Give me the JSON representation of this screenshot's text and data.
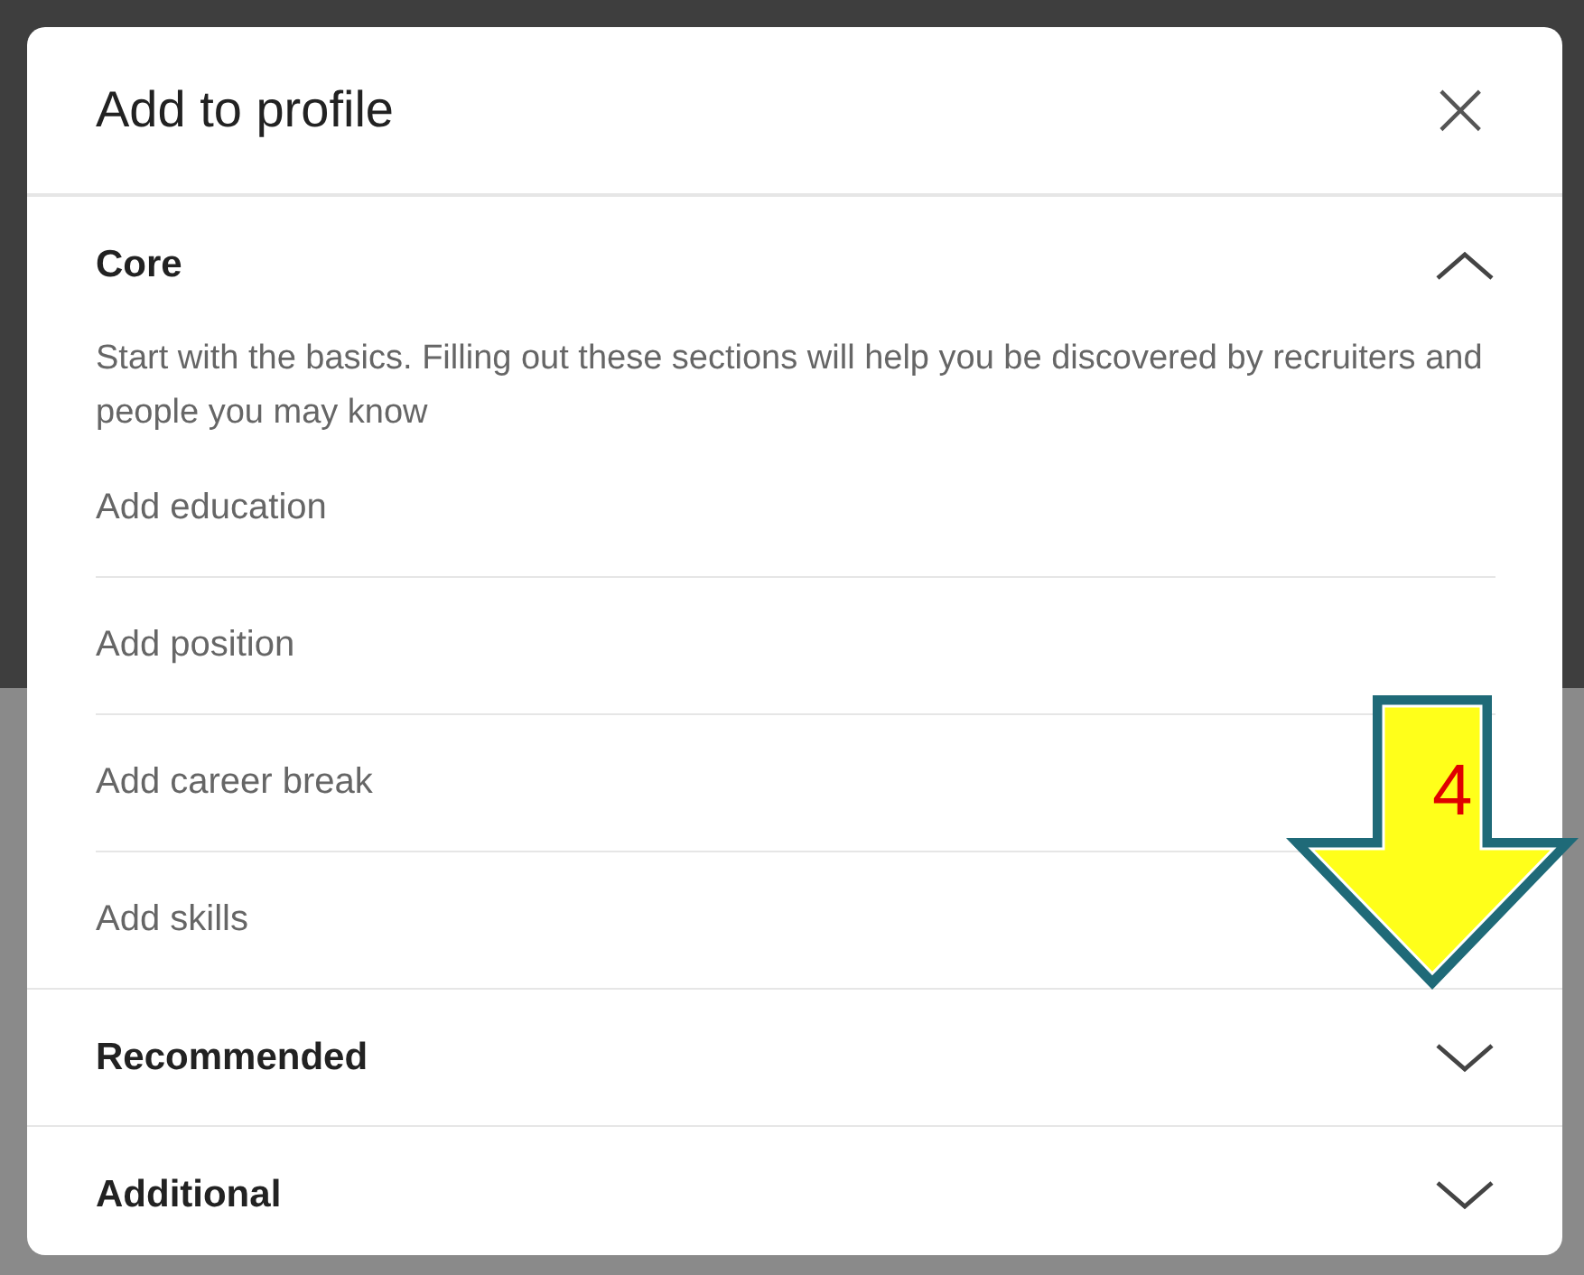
{
  "dialog": {
    "title": "Add to profile",
    "close": "×"
  },
  "sections": [
    {
      "title": "Core",
      "expanded": true,
      "description": "Start with the basics. Filling out these sections will help you be discovered by recruiters and people you may know",
      "items": [
        "Add education",
        "Add position",
        "Add career break",
        "Add skills"
      ]
    },
    {
      "title": "Recommended",
      "expanded": false
    },
    {
      "title": "Additional",
      "expanded": false
    }
  ],
  "annotation": {
    "label": "4"
  }
}
